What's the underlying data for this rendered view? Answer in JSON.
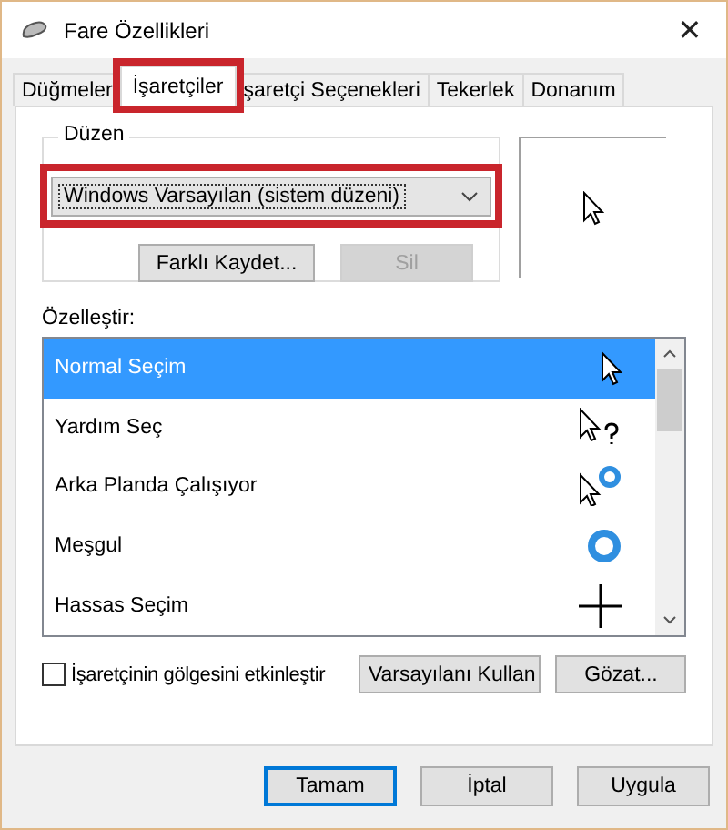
{
  "window": {
    "title": "Fare Özellikleri",
    "close": "✕"
  },
  "tabs": [
    {
      "label": "Düğmeler",
      "selected": false,
      "highlighted": false
    },
    {
      "label": "İşaretçiler",
      "selected": true,
      "highlighted": true
    },
    {
      "label": "şaretçi Seçenekleri",
      "selected": false,
      "highlighted": false
    },
    {
      "label": "Tekerlek",
      "selected": false,
      "highlighted": false
    },
    {
      "label": "Donanım",
      "selected": false,
      "highlighted": false
    }
  ],
  "scheme": {
    "label": "Düzen",
    "value": "Windows Varsayılan (sistem düzeni)",
    "highlighted": true,
    "buttons": [
      {
        "label": "Farklı Kaydet...",
        "disabled": false
      },
      {
        "label": "Sil",
        "disabled": true
      }
    ]
  },
  "customize": {
    "label": "Özelleştir:",
    "items": [
      {
        "name": "Normal Seçim",
        "kind": "arrow",
        "selected": true
      },
      {
        "name": "Yardım Seç",
        "kind": "help",
        "selected": false
      },
      {
        "name": "Arka Planda Çalışıyor",
        "kind": "working",
        "selected": false
      },
      {
        "name": "Meşgul",
        "kind": "busy",
        "selected": false
      },
      {
        "name": "Hassas Seçim",
        "kind": "cross",
        "selected": false
      }
    ]
  },
  "shadow": {
    "label": "İşaretçinin gölgesini etkinleştir",
    "checked": false
  },
  "list_buttons": [
    "Varsayılanı Kullan",
    "Gözat..."
  ],
  "footer_buttons": [
    {
      "label": "Tamam",
      "default": true
    },
    {
      "label": "İptal",
      "default": false
    },
    {
      "label": "Uygula",
      "default": false
    }
  ]
}
